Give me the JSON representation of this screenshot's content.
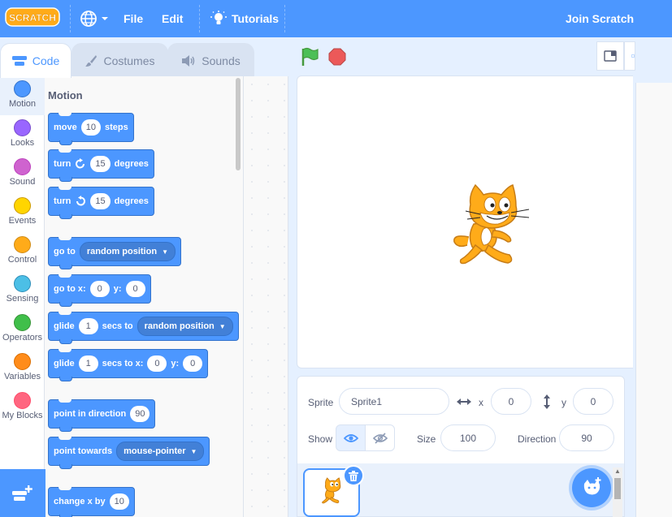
{
  "menubar": {
    "logo_text": "SCRATCH",
    "file": "File",
    "edit": "Edit",
    "tutorials": "Tutorials",
    "join": "Join Scratch"
  },
  "tabs": {
    "code": "Code",
    "costumes": "Costumes",
    "sounds": "Sounds"
  },
  "categories": [
    {
      "label": "Motion",
      "color": "#4c97ff"
    },
    {
      "label": "Looks",
      "color": "#9966ff"
    },
    {
      "label": "Sound",
      "color": "#cf63cf"
    },
    {
      "label": "Events",
      "color": "#ffd500"
    },
    {
      "label": "Control",
      "color": "#ffab19"
    },
    {
      "label": "Sensing",
      "color": "#4cbfe6"
    },
    {
      "label": "Operators",
      "color": "#40bf4a"
    },
    {
      "label": "Variables",
      "color": "#ff8c1a"
    },
    {
      "label": "My Blocks",
      "color": "#ff6680"
    }
  ],
  "palette": {
    "section": "Motion",
    "move": {
      "a": "move",
      "v": "10",
      "b": "steps"
    },
    "turn_right": {
      "a": "turn",
      "v": "15",
      "b": "degrees"
    },
    "turn_left": {
      "a": "turn",
      "v": "15",
      "b": "degrees"
    },
    "go_to": {
      "a": "go to",
      "dd": "random position"
    },
    "go_to_xy": {
      "a": "go to x:",
      "x": "0",
      "b": "y:",
      "y": "0"
    },
    "glide_to": {
      "a": "glide",
      "v": "1",
      "b": "secs to",
      "dd": "random position"
    },
    "glide_xy": {
      "a": "glide",
      "v": "1",
      "b": "secs to x:",
      "x": "0",
      "c": "y:",
      "y": "0"
    },
    "point_dir": {
      "a": "point in direction",
      "v": "90"
    },
    "point_towards": {
      "a": "point towards",
      "dd": "mouse-pointer"
    },
    "change_x": {
      "a": "change x by",
      "v": "10"
    }
  },
  "sprite_info": {
    "sprite_label": "Sprite",
    "sprite_name": "Sprite1",
    "x_label": "x",
    "x_value": "0",
    "y_label": "y",
    "y_value": "0",
    "show_label": "Show",
    "size_label": "Size",
    "size_value": "100",
    "direction_label": "Direction",
    "direction_value": "90"
  },
  "colors": {
    "accent": "#4c97ff",
    "motion_block": "#4c97ff",
    "cat_orange": "#ffab19"
  },
  "icons": [
    "globe-icon",
    "lightbulb-icon",
    "green-flag-icon",
    "stop-icon",
    "eye-icon",
    "eye-slash-icon",
    "trash-icon",
    "choose-sprite-icon",
    "add-extension-icon"
  ]
}
